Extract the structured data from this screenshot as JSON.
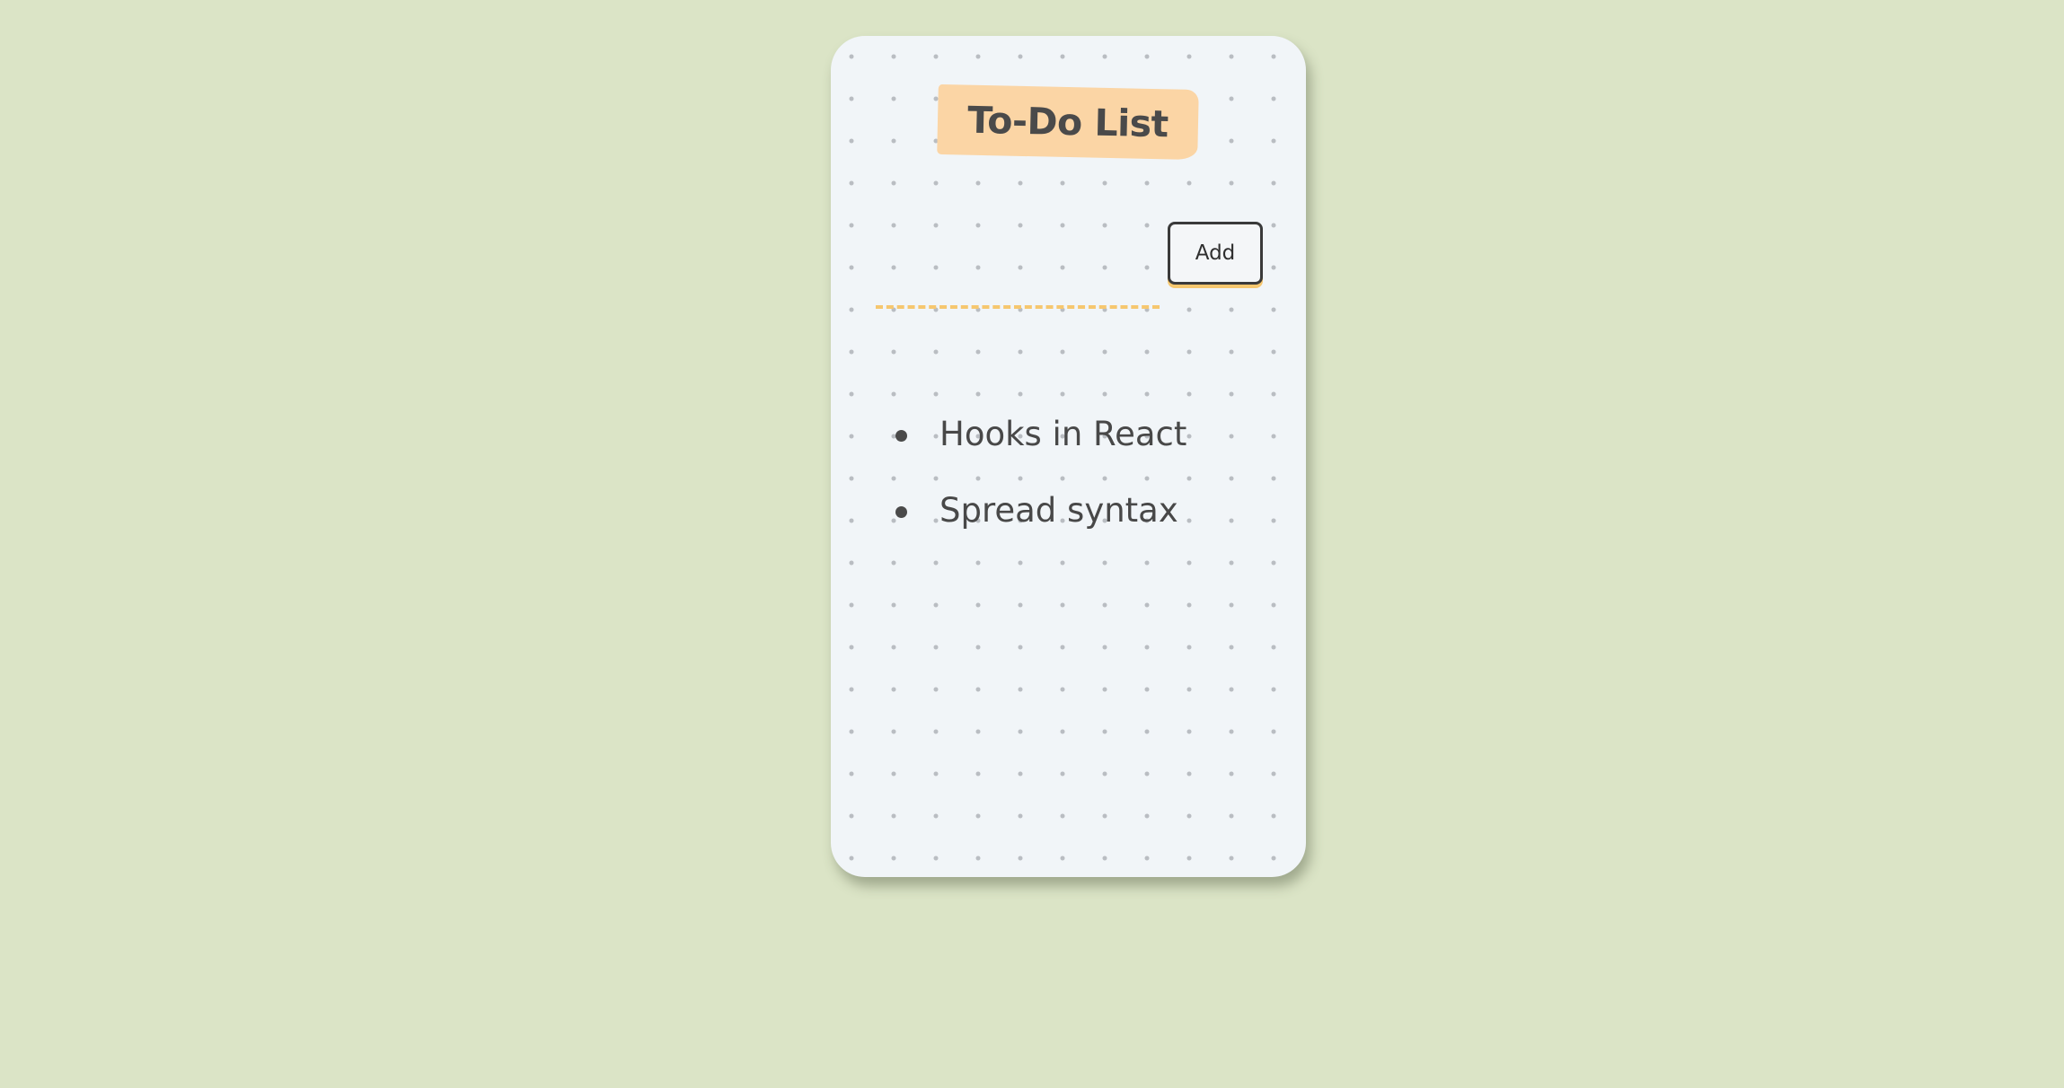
{
  "app": {
    "title": "To-Do List"
  },
  "form": {
    "input_value": "",
    "input_placeholder": "",
    "add_label": "Add"
  },
  "todos": [
    {
      "text": "Hooks in React"
    },
    {
      "text": "Spread syntax"
    }
  ],
  "colors": {
    "page_background": "#dbe4c6",
    "card_background": "#f1f5f8",
    "title_highlight": "#fbd5a5",
    "accent_underline": "#f6c76f",
    "text": "#484848"
  }
}
